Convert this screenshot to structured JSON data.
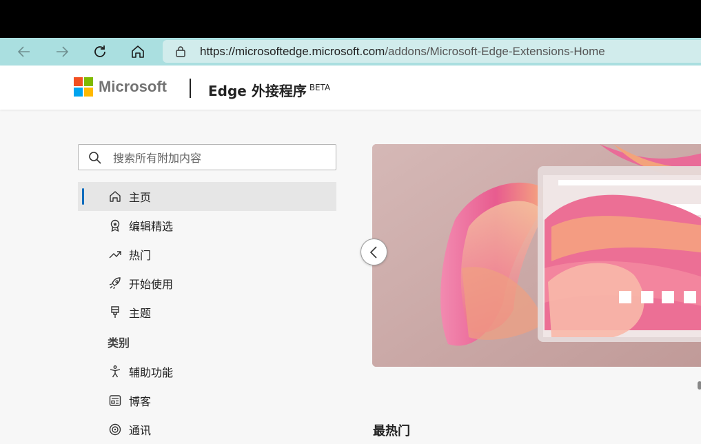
{
  "browser": {
    "url_host": "https://microsoftedge.microsoft.com",
    "url_path": "/addons/Microsoft-Edge-Extensions-Home"
  },
  "header": {
    "brand": "Microsoft",
    "title": "Edge 外接程序",
    "badge": "BETA",
    "logo_colors": [
      "#f25022",
      "#7fba00",
      "#00a4ef",
      "#ffb900"
    ]
  },
  "search": {
    "placeholder": "搜索所有附加内容",
    "value": ""
  },
  "sidebar": {
    "items": [
      {
        "label": "主页",
        "icon": "home-icon",
        "active": true
      },
      {
        "label": "编辑精选",
        "icon": "award-icon"
      },
      {
        "label": "热门",
        "icon": "trending-icon"
      },
      {
        "label": "开始使用",
        "icon": "rocket-icon"
      },
      {
        "label": "主题",
        "icon": "brush-icon"
      }
    ],
    "category_header": "类别",
    "categories": [
      {
        "label": "辅助功能",
        "icon": "accessibility-icon"
      },
      {
        "label": "博客",
        "icon": "blog-icon"
      },
      {
        "label": "通讯",
        "icon": "communication-icon"
      }
    ]
  },
  "main": {
    "section_title": "最热门"
  },
  "colors": {
    "browser_bar": "#aadfe0",
    "accent": "#0f6cbd"
  }
}
